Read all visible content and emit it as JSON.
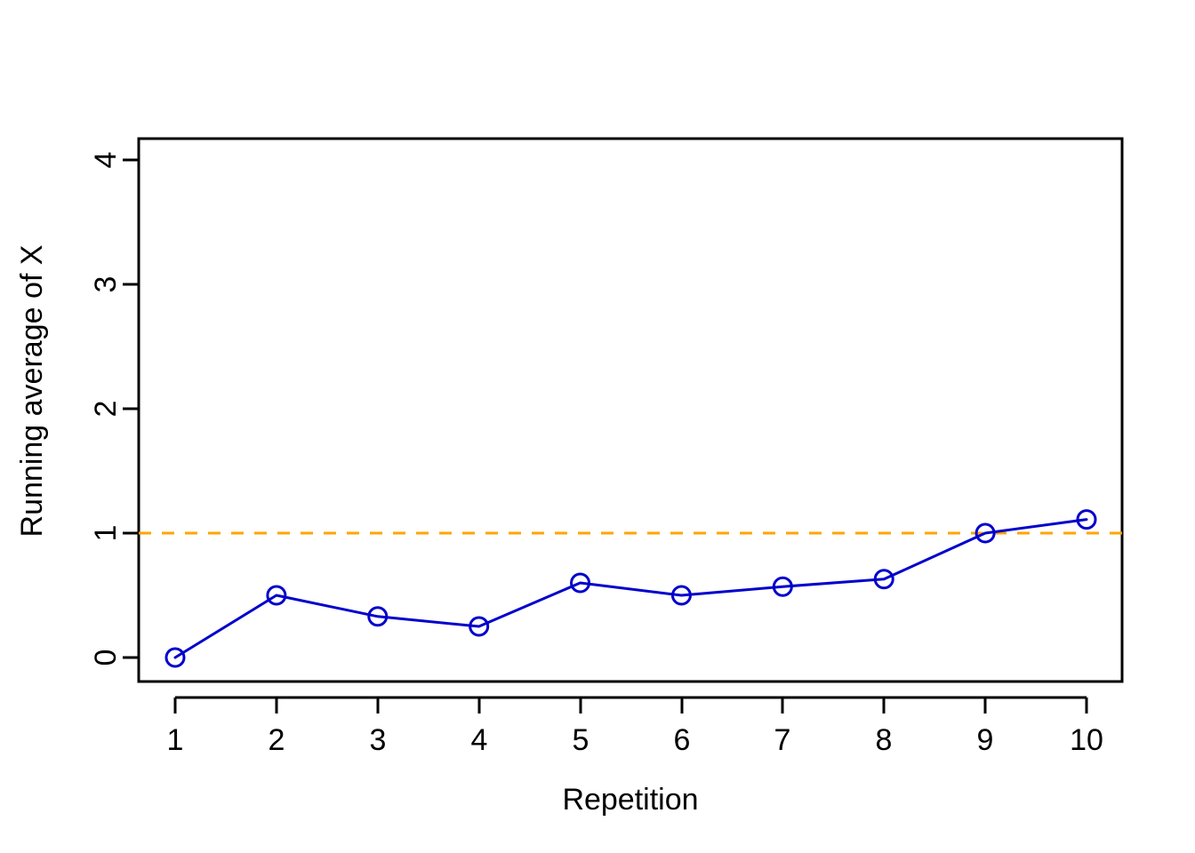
{
  "chart_data": {
    "type": "line",
    "title": "",
    "xlabel": "Repetition",
    "ylabel": "Running average of X",
    "x": [
      1,
      2,
      3,
      4,
      5,
      6,
      7,
      8,
      9,
      10
    ],
    "values": [
      0,
      0.5,
      0.33,
      0.25,
      0.6,
      0.5,
      0.57,
      0.63,
      1.0,
      1.11
    ],
    "series": [
      {
        "name": "Running average of X",
        "values": [
          0,
          0.5,
          0.33,
          0.25,
          0.6,
          0.5,
          0.57,
          0.63,
          1.0,
          1.11
        ],
        "color": "#0000CC",
        "marker": "open-circle",
        "line_style": "solid"
      }
    ],
    "annotations": [
      {
        "type": "horizontal-reference-line",
        "label": "",
        "y": 1,
        "color": "#FFA500",
        "line_style": "dashed"
      }
    ],
    "xlim": [
      0.55,
      10.45
    ],
    "ylim": [
      -0.19,
      4.19
    ],
    "xticks": [
      1,
      2,
      3,
      4,
      5,
      6,
      7,
      8,
      9,
      10
    ],
    "xtick_labels": [
      "1",
      "2",
      "3",
      "4",
      "5",
      "6",
      "7",
      "8",
      "9",
      "10"
    ],
    "yticks": [
      0,
      1,
      2,
      3,
      4
    ],
    "ytick_labels": [
      "0",
      "1",
      "2",
      "3",
      "4"
    ],
    "grid": false,
    "legend": "none",
    "background": "#FFFFFF",
    "frame": "box"
  }
}
